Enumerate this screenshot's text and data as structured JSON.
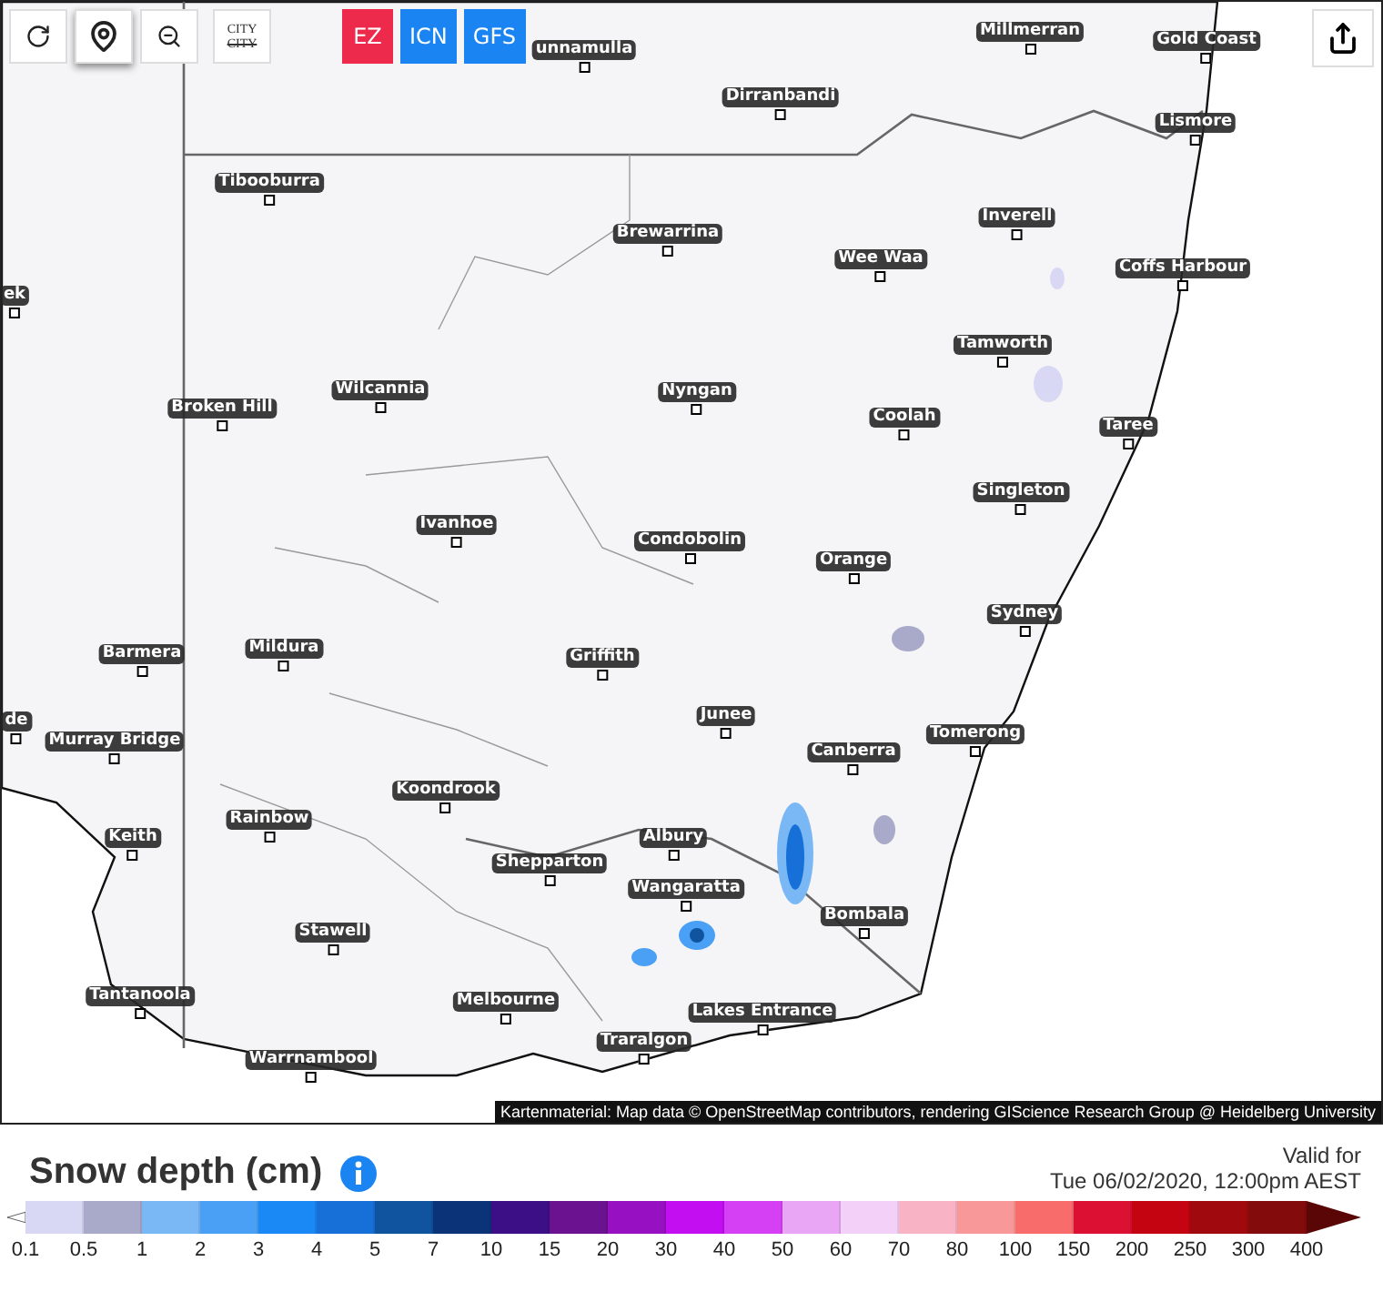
{
  "toolbar": {
    "city_toggle": {
      "top": "CITY",
      "bottom": "CITY"
    },
    "pin_selected": true
  },
  "models": [
    {
      "label": "EZ",
      "color": "#ee2a4c"
    },
    {
      "label": "ICN",
      "color": "#1a85f2"
    },
    {
      "label": "GFS",
      "color": "#1a85f2"
    }
  ],
  "map": {
    "cities": [
      "unnamulla",
      "Millmerran",
      "Gold Coast",
      "Dirranbandi",
      "Lismore",
      "Tibooburra",
      "Brewarrina",
      "Inverell",
      "Wee Waa",
      "Coffs Harbour",
      "Tamworth",
      "Wilcannia",
      "Nyngan",
      "Coolah",
      "Broken Hill",
      "Taree",
      "Singleton",
      "Ivanhoe",
      "Condobolin",
      "Orange",
      "Sydney",
      "Barmera",
      "Mildura",
      "Griffith",
      "Junee",
      "Murray Bridge",
      "Tomerong",
      "Canberra",
      "Koondrook",
      "Rainbow",
      "Keith",
      "Albury",
      "Shepparton",
      "Wangaratta",
      "Bombala",
      "Stawell",
      "Tantanoola",
      "Melbourne",
      "Lakes Entrance",
      "Traralgon",
      "Warrnambool",
      "ek",
      "de"
    ],
    "attribution": "Kartenmaterial: Map data © OpenStreetMap contributors, rendering GIScience Research Group @ Heidelberg University"
  },
  "legend": {
    "title": "Snow depth (cm)",
    "valid_label": "Valid for",
    "valid_time": "Tue 06/02/2020, 12:00pm AEST",
    "scale": [
      {
        "label": "0.1",
        "color": "#d8d8f4"
      },
      {
        "label": "0.5",
        "color": "#a9a9c9"
      },
      {
        "label": "1",
        "color": "#7ab8f5"
      },
      {
        "label": "2",
        "color": "#4aa0f5"
      },
      {
        "label": "3",
        "color": "#1a88f5"
      },
      {
        "label": "4",
        "color": "#1770d8"
      },
      {
        "label": "5",
        "color": "#10539e"
      },
      {
        "label": "7",
        "color": "#0b3478"
      },
      {
        "label": "10",
        "color": "#3d0f86"
      },
      {
        "label": "15",
        "color": "#6a1290"
      },
      {
        "label": "20",
        "color": "#9710c2"
      },
      {
        "label": "30",
        "color": "#c20ef0"
      },
      {
        "label": "40",
        "color": "#d640f4"
      },
      {
        "label": "50",
        "color": "#e8a6f4"
      },
      {
        "label": "60",
        "color": "#f3d0f8"
      },
      {
        "label": "70",
        "color": "#f8b4c4"
      },
      {
        "label": "80",
        "color": "#f99898"
      },
      {
        "label": "100",
        "color": "#f96c6c"
      },
      {
        "label": "150",
        "color": "#dc1032"
      },
      {
        "label": "200",
        "color": "#c40410"
      },
      {
        "label": "250",
        "color": "#a00a0e"
      },
      {
        "label": "300",
        "color": "#830b0b"
      },
      {
        "label": "400",
        "color": "#5a0606"
      }
    ]
  }
}
